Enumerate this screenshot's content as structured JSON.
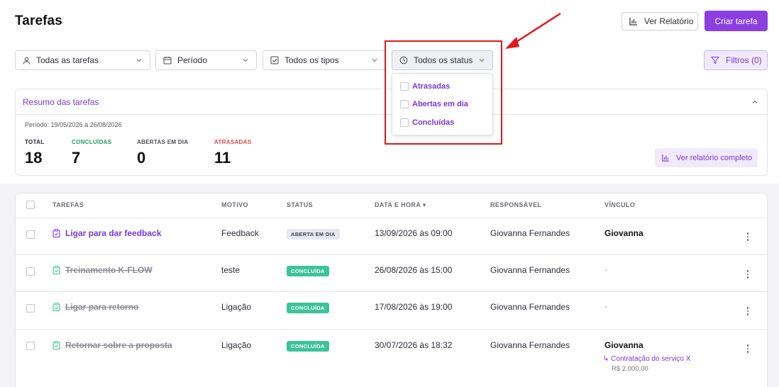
{
  "header": {
    "title": "Tarefas",
    "report_button": "Ver Relatório",
    "create_button": "Criar tarefa"
  },
  "filters": {
    "owner": "Todas as tarefas",
    "period": "Período",
    "types": "Todos os tipos",
    "status": "Todos os status",
    "more_filters": "Filtros (0)"
  },
  "status_dropdown": {
    "options": [
      "Atrasadas",
      "Abertas em dia",
      "Concluídas"
    ]
  },
  "summary": {
    "title": "Resumo das tarefas",
    "period": "Período: 19/05/2026 à 26/08/2026",
    "stats": [
      {
        "label": "TOTAL",
        "value": "18",
        "color": "#1f2030"
      },
      {
        "label": "CONCLUÍDAS",
        "value": "7",
        "color": "#22a06b"
      },
      {
        "label": "ABERTAS EM DIA",
        "value": "0",
        "color": "#4a4b57"
      },
      {
        "label": "ATRASADAS",
        "value": "11",
        "color": "#e5484d"
      }
    ],
    "full_report_button": "Ver relatório completo"
  },
  "table": {
    "headers": {
      "tasks": "TAREFAS",
      "reason": "MOTIVO",
      "status": "STATUS",
      "date": "DATA E HORA ▾",
      "owner": "RESPONSÁVEL",
      "link": "VÍNCULO"
    },
    "rows": [
      {
        "task": "Ligar para dar feedback",
        "reason": "Feedback",
        "status": "ABERTA EM DIA",
        "date": "13/09/2026 às 09:00",
        "owner": "Giovanna Fernandes",
        "link": "Giovanna"
      },
      {
        "task": "Treinamento K-FLOW",
        "reason": "teste",
        "status": "CONCLUÍDA",
        "date": "26/08/2026 às 15:00",
        "owner": "Giovanna Fernandes",
        "link": "-"
      },
      {
        "task": "Ligar para retorno",
        "reason": "Ligação",
        "status": "CONCLUÍDA",
        "date": "17/08/2026 às 19:00",
        "owner": "Giovanna Fernandes",
        "link": "-"
      },
      {
        "task": "Retornar sobre a proposta",
        "reason": "Ligação",
        "status": "CONCLUÍDA",
        "date": "30/07/2026 às 18:32",
        "owner": "Giovanna Fernandes",
        "link": "Giovanna",
        "link_detail": "↳ Contratação do serviço X",
        "link_value": "R$ 2.000,00"
      }
    ]
  },
  "colors": {
    "accent": "#8b3fe0",
    "accent_text": "#7a38d8",
    "highlight": "#e0171d",
    "done_badge": "#3cc39a"
  }
}
